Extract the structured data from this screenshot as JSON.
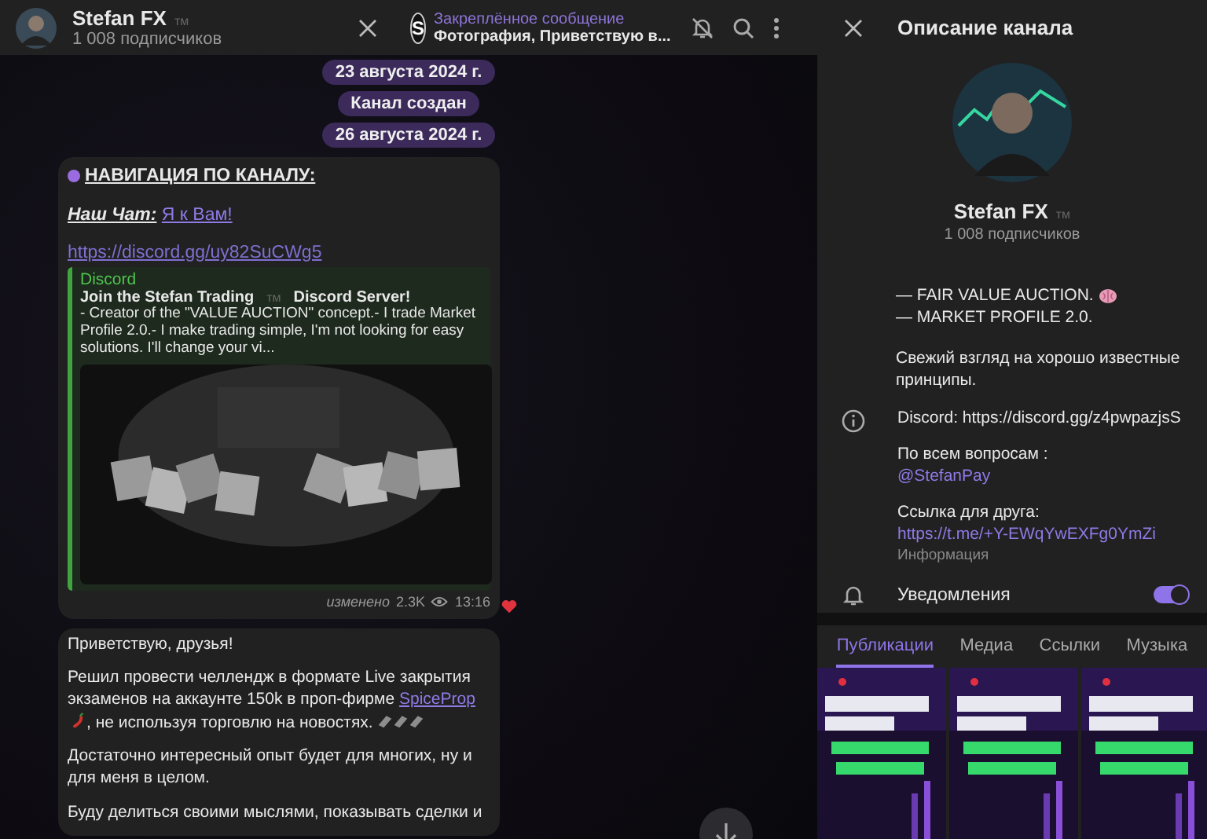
{
  "header": {
    "title": "Stefan FX",
    "badge": "тм",
    "subtitle": "1 008 подписчиков"
  },
  "pinned": {
    "logo": "S",
    "label": "Закреплённое сообщение",
    "text": "Фотография, Приветствую в..."
  },
  "service": [
    "23 августа 2024 г.",
    "Канал создан",
    "26 августа 2024 г."
  ],
  "post1": {
    "heading": "НАВИГАЦИЯ ПО КАНАЛУ:",
    "chat_label": "Наш Чат:",
    "chat_link": "Я к Вам!",
    "link": "https://discord.gg/uy82SuCWg5",
    "preview": {
      "site": "Discord",
      "title_start": "Join the Stefan Trading",
      "title_mark": "тм",
      "title_end": "Discord Server!",
      "description": "- Creator of the \"VALUE AUCTION\" concept.- I trade Market Profile 2.0.- I make trading simple, I'm not looking for easy solutions. I'll change your vi..."
    },
    "edited": "изменено",
    "views": "2.3K",
    "time": "13:16"
  },
  "post2": {
    "paragraphs": [
      {
        "kind": "plain",
        "text": "Приветствую, друзья!"
      },
      {
        "kind": "link",
        "before": "Решил провести челлендж в формате Live закрытия экзаменов на аккаунте 150k в проп-фирме ",
        "link": "SpiceProp",
        "after": ", не используя торговлю на новостях."
      },
      {
        "kind": "plain",
        "text": "Достаточно интересный опыт будет для многих, ну и для меня в целом."
      },
      {
        "kind": "plain",
        "text": "Буду делиться своими мыслями, показывать сделки и"
      }
    ]
  },
  "panel": {
    "title": "Описание канала",
    "name": "Stefan FX",
    "badge": "тм",
    "subtitle": "1 008 подписчиков",
    "description": [
      "— FAIR VALUE AUCTION.",
      "— MARKET PROFILE 2.0.",
      "Свежий взгляд на хорошо известные принципы."
    ],
    "info": [
      {
        "label": "Discord: https://discord.gg/z4pwpazjsS"
      },
      {
        "label": "По всем вопросам : ",
        "link": "@StefanPay"
      },
      {
        "label": "Ссылка для друга: ",
        "link": "https://t.me/+Y-EWqYwEXFg0YmZi"
      }
    ],
    "info_caption": "Информация",
    "notifications": {
      "label": "Уведомления",
      "on": true
    },
    "tabs": [
      {
        "label": "Публикации",
        "selected": true
      },
      {
        "label": "Медиа",
        "selected": false
      },
      {
        "label": "Ссылки",
        "selected": false
      },
      {
        "label": "Музыка",
        "selected": false
      }
    ],
    "media": [
      {
        "kind": "picture"
      },
      {
        "kind": "picture"
      },
      {
        "kind": "picture"
      }
    ]
  }
}
